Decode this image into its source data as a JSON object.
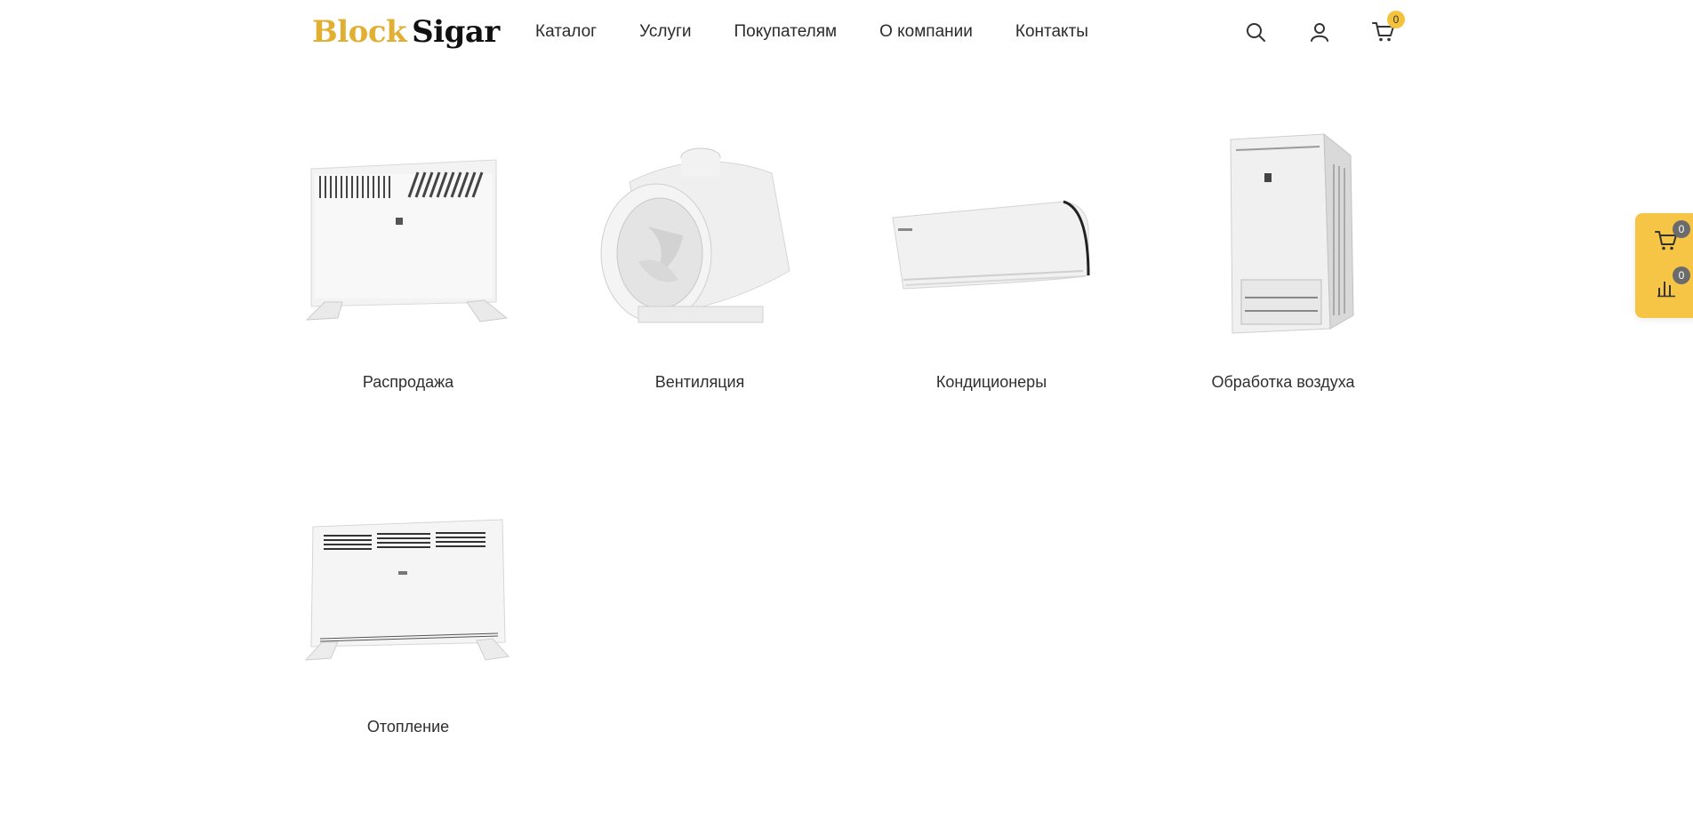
{
  "header": {
    "logo_part1": "Block",
    "logo_part2": "Sigar",
    "nav": [
      {
        "label": "Каталог"
      },
      {
        "label": "Услуги"
      },
      {
        "label": "Покупателям"
      },
      {
        "label": "О компании"
      },
      {
        "label": "Контакты"
      }
    ],
    "cart_count": "0"
  },
  "categories": [
    {
      "label": "Распродажа",
      "image": "convector-heater"
    },
    {
      "label": "Вентиляция",
      "image": "duct-fan"
    },
    {
      "label": "Кондиционеры",
      "image": "wall-air-conditioner"
    },
    {
      "label": "Обработка воздуха",
      "image": "air-purifier"
    },
    {
      "label": "Отопление",
      "image": "panel-heater"
    }
  ],
  "side_panel": {
    "cart_count": "0",
    "compare_count": "0"
  },
  "colors": {
    "accent": "#f7c545",
    "logo_gold": "#e1b033",
    "text": "#2b2b2b"
  }
}
